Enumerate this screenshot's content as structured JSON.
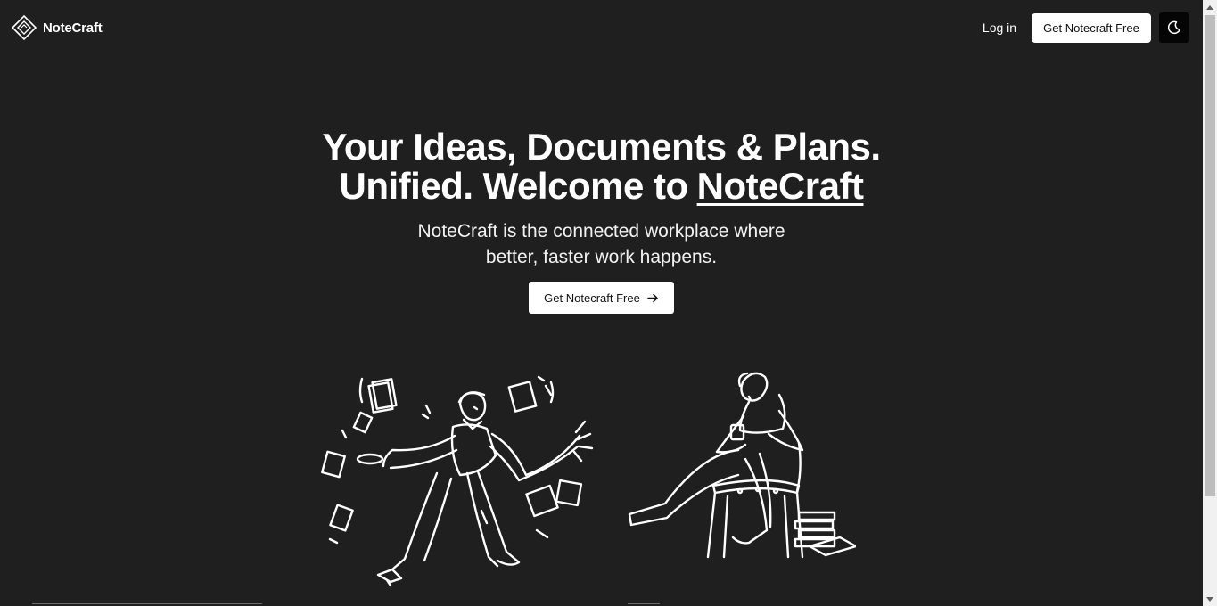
{
  "header": {
    "brand": "NoteCraft",
    "login_label": "Log in",
    "cta_label": "Get Notecraft Free",
    "logo_icon": "diamond-logo-icon",
    "theme_icon": "moon-icon"
  },
  "hero": {
    "headline_line1": "Your Ideas, Documents & Plans.",
    "headline_line2_prefix": "Unified. Welcome to",
    "headline_brand": "NoteCraft",
    "subtitle_line1": "NoteCraft is the connected workplace where",
    "subtitle_line2": "better, faster work happens.",
    "cta_label": "Get Notecraft Free",
    "cta_icon": "arrow-right-icon"
  },
  "colors": {
    "background": "#1f1f1f",
    "text": "#ffffff",
    "button_bg": "#ffffff",
    "button_text": "#111111"
  }
}
